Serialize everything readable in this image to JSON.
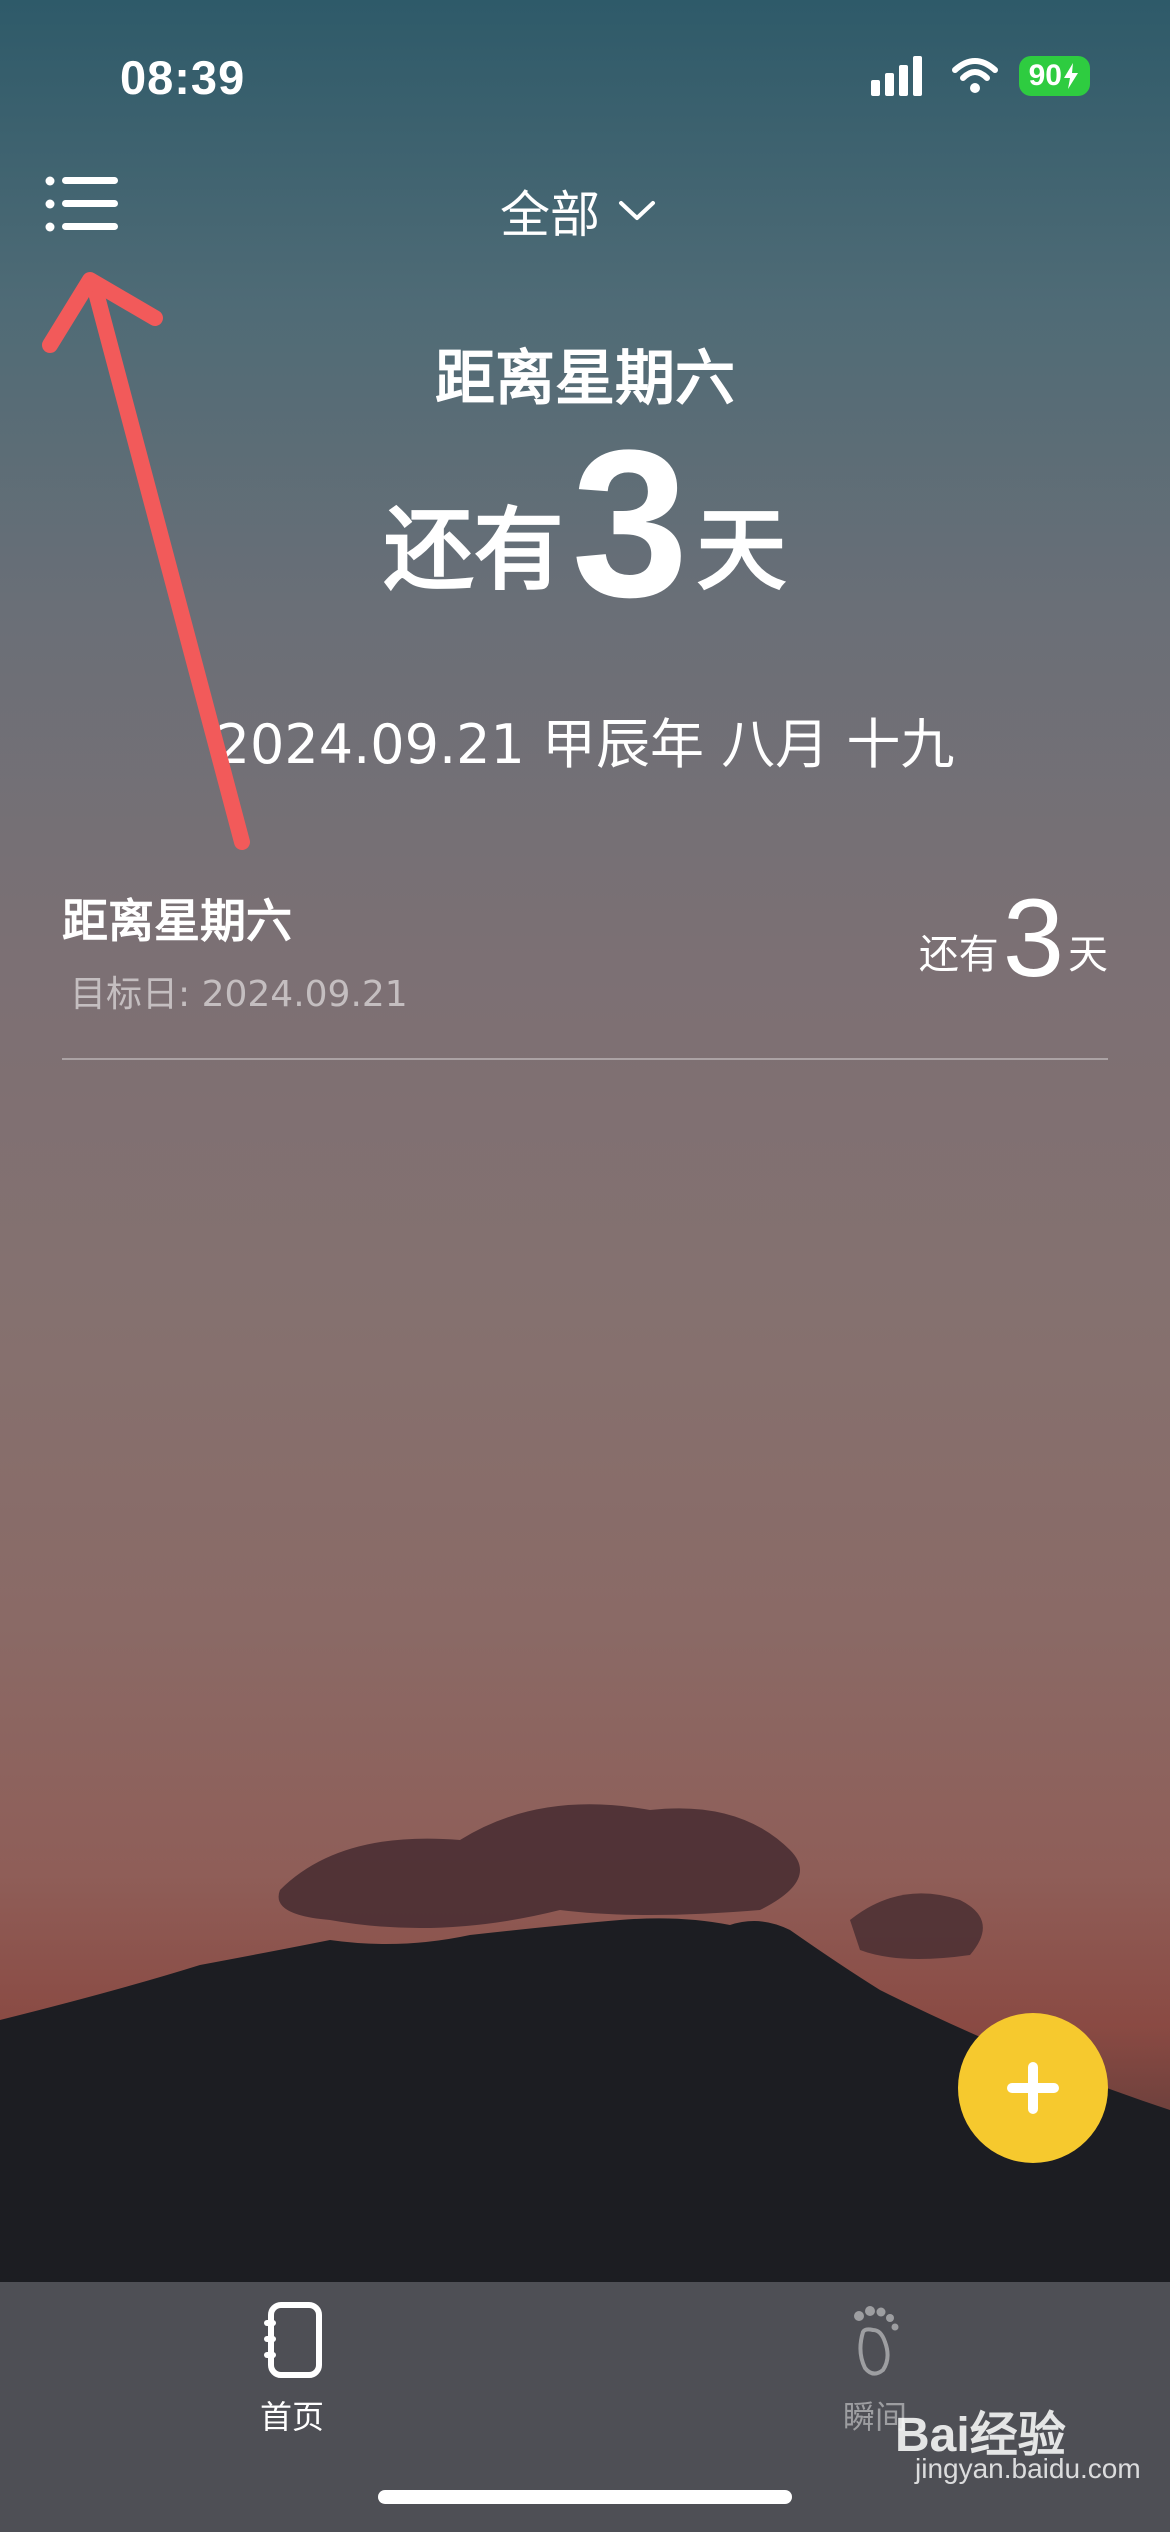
{
  "status_bar": {
    "time": "08:39",
    "battery": "90"
  },
  "header": {
    "filter_label": "全部"
  },
  "hero": {
    "title": "距离星期六",
    "count_prefix": "还有",
    "count_value": "3",
    "count_suffix": "天",
    "date_line": "2024.09.21 甲辰年 八月 十九"
  },
  "list": [
    {
      "title": "距离星期六",
      "target": "目标日: 2024.09.21",
      "prefix": "还有",
      "value": "3",
      "suffix": "天"
    }
  ],
  "tabbar": {
    "tabs": [
      {
        "label": "首页",
        "icon": "notebook-icon",
        "active": true
      },
      {
        "label": "瞬间",
        "icon": "footprint-icon",
        "active": false
      }
    ]
  },
  "watermark": {
    "text": "Bai经验",
    "url": "jingyan.baidu.com"
  },
  "colors": {
    "fab": "#f6c92e",
    "annotation_arrow": "#f25a5a",
    "tabbar": "#4e4f55",
    "battery": "#2ecc40"
  }
}
